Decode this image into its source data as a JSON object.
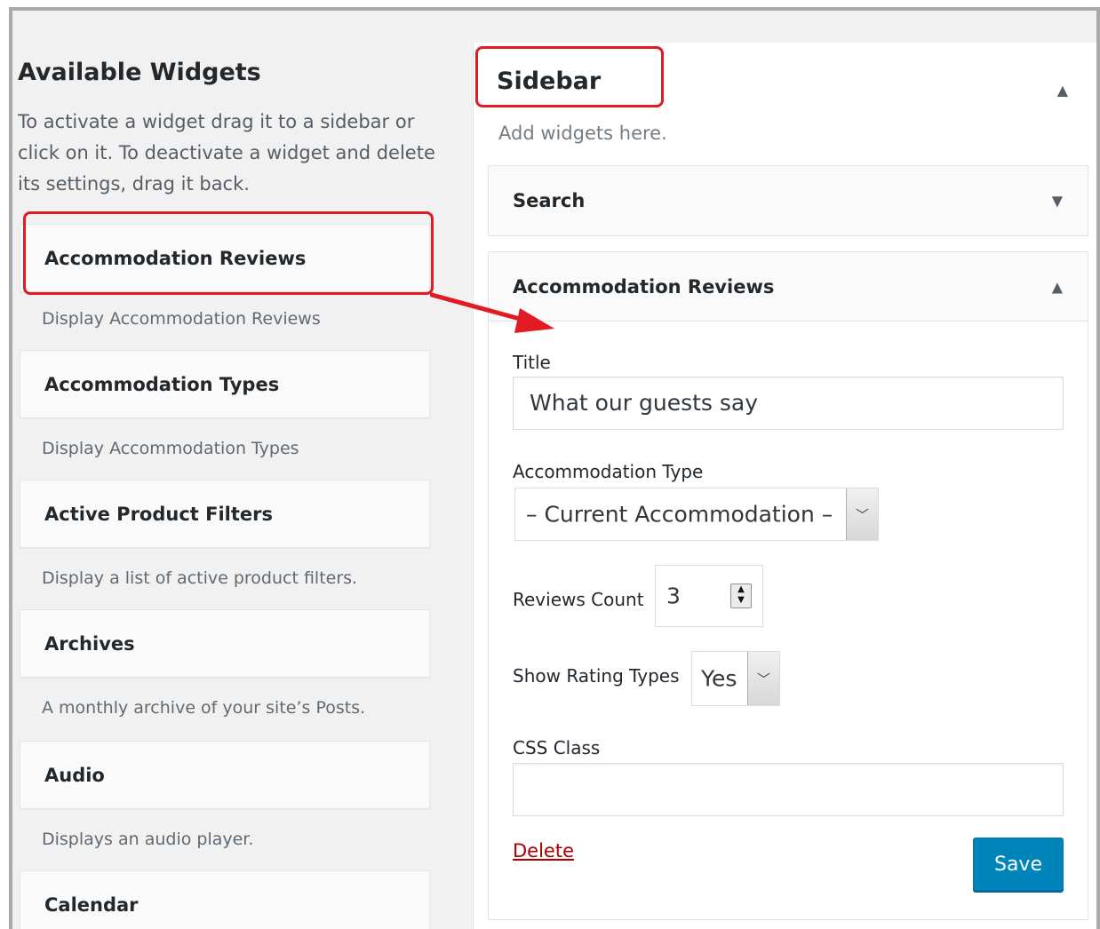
{
  "available": {
    "title": "Available Widgets",
    "description": "To activate a widget drag it to a sidebar or click on it. To deactivate a widget and delete its settings, drag it back.",
    "widgets": [
      {
        "name": "Accommodation Reviews",
        "desc": "Display Accommodation Reviews"
      },
      {
        "name": "Accommodation Types",
        "desc": "Display Accommodation Types"
      },
      {
        "name": "Active Product Filters",
        "desc": "Display a list of active product filters."
      },
      {
        "name": "Archives",
        "desc": "A monthly archive of your site’s Posts."
      },
      {
        "name": "Audio",
        "desc": "Displays an audio player."
      },
      {
        "name": "Calendar",
        "desc": ""
      }
    ]
  },
  "sidebar": {
    "title": "Sidebar",
    "description": "Add widgets here.",
    "toggle_icon": "triangle-up-icon",
    "search_widget": {
      "label": "Search",
      "toggle_icon": "triangle-down-icon"
    },
    "acc_widget": {
      "label": "Accommodation Reviews",
      "toggle_icon": "triangle-up-icon",
      "title_label": "Title",
      "title_value": "What our guests say",
      "type_label": "Accommodation Type",
      "type_value": "– Current Accommodation –",
      "count_label": "Reviews Count",
      "count_value": "3",
      "rating_label": "Show Rating Types",
      "rating_value": "Yes",
      "css_label": "CSS Class",
      "css_value": "",
      "delete_label": "Delete",
      "save_label": "Save"
    }
  },
  "colors": {
    "highlight": "#e01b24",
    "save_button": "#0085ba",
    "delete_link": "#a00000"
  }
}
